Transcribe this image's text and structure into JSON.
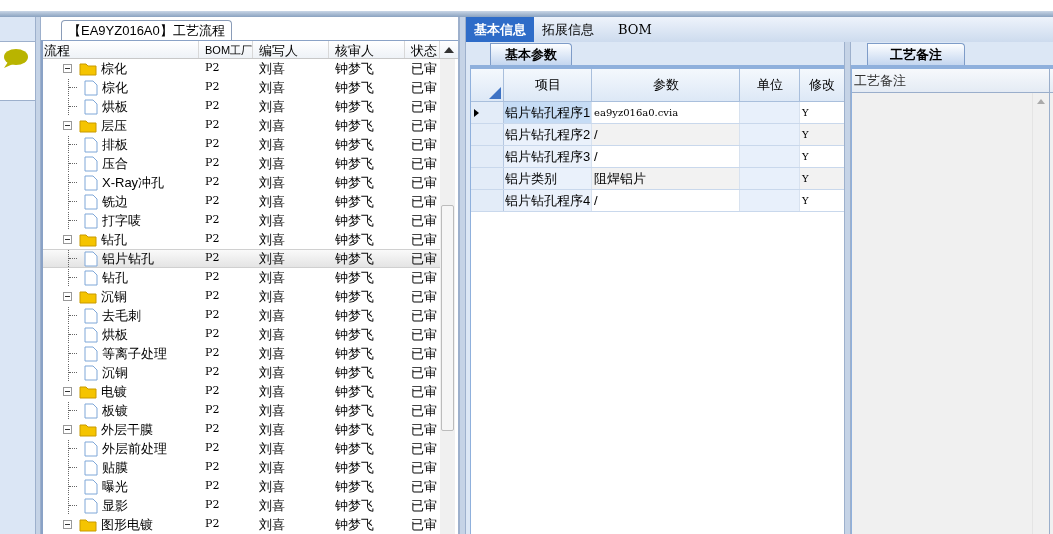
{
  "flow_panel": {
    "title": "【EA9YZ016A0】工艺流程",
    "columns": [
      "流程",
      "BOM工厂",
      "编写人",
      "核审人",
      "状态"
    ],
    "tree": [
      {
        "label": "棕化",
        "expanded": true,
        "selected": false,
        "cells": [
          "P2",
          "刘喜",
          "钟梦飞",
          "已审"
        ],
        "children": [
          {
            "label": "棕化",
            "selected": false,
            "cells": [
              "P2",
              "刘喜",
              "钟梦飞",
              "已审"
            ]
          },
          {
            "label": "烘板",
            "selected": false,
            "cells": [
              "P2",
              "刘喜",
              "钟梦飞",
              "已审"
            ]
          }
        ]
      },
      {
        "label": "层压",
        "expanded": true,
        "selected": false,
        "cells": [
          "P2",
          "刘喜",
          "钟梦飞",
          "已审"
        ],
        "children": [
          {
            "label": "排板",
            "selected": false,
            "cells": [
              "P2",
              "刘喜",
              "钟梦飞",
              "已审"
            ]
          },
          {
            "label": "压合",
            "selected": false,
            "cells": [
              "P2",
              "刘喜",
              "钟梦飞",
              "已审"
            ]
          },
          {
            "label": "X-Ray冲孔",
            "selected": false,
            "cells": [
              "P2",
              "刘喜",
              "钟梦飞",
              "已审"
            ]
          },
          {
            "label": "铣边",
            "selected": false,
            "cells": [
              "P2",
              "刘喜",
              "钟梦飞",
              "已审"
            ]
          },
          {
            "label": "打字唛",
            "selected": false,
            "cells": [
              "P2",
              "刘喜",
              "钟梦飞",
              "已审"
            ]
          }
        ]
      },
      {
        "label": "钻孔",
        "expanded": true,
        "selected": false,
        "cells": [
          "P2",
          "刘喜",
          "钟梦飞",
          "已审"
        ],
        "children": [
          {
            "label": "铝片钻孔",
            "selected": true,
            "cells": [
              "P2",
              "刘喜",
              "钟梦飞",
              "已审"
            ]
          },
          {
            "label": "钻孔",
            "selected": false,
            "cells": [
              "P2",
              "刘喜",
              "钟梦飞",
              "已审"
            ]
          }
        ]
      },
      {
        "label": "沉铜",
        "expanded": true,
        "selected": false,
        "cells": [
          "P2",
          "刘喜",
          "钟梦飞",
          "已审"
        ],
        "children": [
          {
            "label": "去毛刺",
            "selected": false,
            "cells": [
              "P2",
              "刘喜",
              "钟梦飞",
              "已审"
            ]
          },
          {
            "label": "烘板",
            "selected": false,
            "cells": [
              "P2",
              "刘喜",
              "钟梦飞",
              "已审"
            ]
          },
          {
            "label": "等离子处理",
            "selected": false,
            "cells": [
              "P2",
              "刘喜",
              "钟梦飞",
              "已审"
            ]
          },
          {
            "label": "沉铜",
            "selected": false,
            "cells": [
              "P2",
              "刘喜",
              "钟梦飞",
              "已审"
            ]
          }
        ]
      },
      {
        "label": "电镀",
        "expanded": true,
        "selected": false,
        "cells": [
          "P2",
          "刘喜",
          "钟梦飞",
          "已审"
        ],
        "children": [
          {
            "label": "板镀",
            "selected": false,
            "cells": [
              "P2",
              "刘喜",
              "钟梦飞",
              "已审"
            ]
          }
        ]
      },
      {
        "label": "外层干膜",
        "expanded": true,
        "selected": false,
        "cells": [
          "P2",
          "刘喜",
          "钟梦飞",
          "已审"
        ],
        "children": [
          {
            "label": "外层前处理",
            "selected": false,
            "cells": [
              "P2",
              "刘喜",
              "钟梦飞",
              "已审"
            ]
          },
          {
            "label": "贴膜",
            "selected": false,
            "cells": [
              "P2",
              "刘喜",
              "钟梦飞",
              "已审"
            ]
          },
          {
            "label": "曝光",
            "selected": false,
            "cells": [
              "P2",
              "刘喜",
              "钟梦飞",
              "已审"
            ]
          },
          {
            "label": "显影",
            "selected": false,
            "cells": [
              "P2",
              "刘喜",
              "钟梦飞",
              "已审"
            ]
          }
        ]
      },
      {
        "label": "图形电镀",
        "expanded": true,
        "selected": false,
        "cells": [
          "P2",
          "刘喜",
          "钟梦飞",
          "已审"
        ]
      }
    ]
  },
  "tabs": [
    {
      "label": "基本信息",
      "selected": true
    },
    {
      "label": "拓展信息",
      "selected": false
    },
    {
      "label": "BOM",
      "selected": false
    }
  ],
  "params_panel": {
    "tab": "基本参数",
    "columns": [
      "项目",
      "参数",
      "单位",
      "修改"
    ],
    "rows": [
      {
        "selected": true,
        "cells": [
          "铝片钻孔程序1",
          "ea9yz016a0.cvia",
          "",
          "Y"
        ]
      },
      {
        "selected": false,
        "cells": [
          "铝片钻孔程序2",
          "/",
          "",
          "Y"
        ]
      },
      {
        "selected": false,
        "cells": [
          "铝片钻孔程序3",
          "/",
          "",
          "Y"
        ]
      },
      {
        "selected": false,
        "cells": [
          "铝片类别",
          "阻焊铝片",
          "",
          "Y"
        ]
      },
      {
        "selected": false,
        "cells": [
          "铝片钻孔程序4",
          "/",
          "",
          "Y"
        ]
      }
    ]
  },
  "notes_panel": {
    "tab": "工艺备注",
    "column": "工艺备注"
  }
}
